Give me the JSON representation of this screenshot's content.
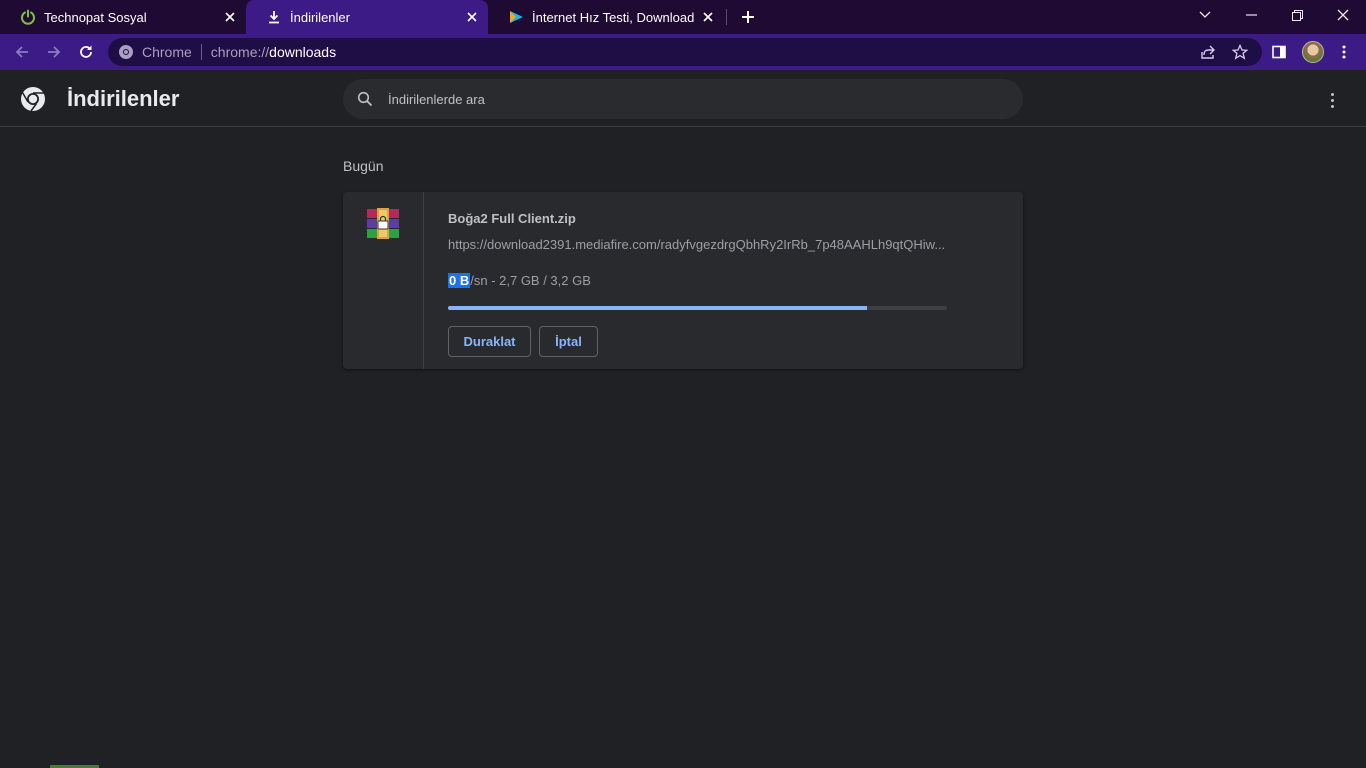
{
  "tabs": [
    {
      "title": "Technopat Sosyal",
      "icon": "power-icon",
      "active": false
    },
    {
      "title": "İndirilenler",
      "icon": "download-icon",
      "active": true
    },
    {
      "title": "İnternet Hız Testi, Download & Up",
      "icon": "play-icon",
      "active": false
    }
  ],
  "omnibox": {
    "site_label": "Chrome",
    "url_scheme": "chrome://",
    "url_host": "downloads"
  },
  "page": {
    "title": "İndirilenler",
    "search_placeholder": "İndirilenlerde ara"
  },
  "downloads": {
    "date_header": "Bugün",
    "items": [
      {
        "file_name": "Boğa2 Full Client.zip",
        "url": "https://download2391.mediafire.com/radyfvgezdrgQbhRy2IrRb_7p48AAHLh9qtQHiw...",
        "speed_value": "0 B",
        "status_rest": "/sn - 2,7 GB / 3,2 GB",
        "progress": 0.84,
        "pause_label": "Duraklat",
        "cancel_label": "İptal",
        "icon": "winrar-archive-icon"
      }
    ]
  },
  "colors": {
    "tabstrip": "#1f0a33",
    "toolbar": "#3c1b86",
    "page_bg": "#202124",
    "card_bg": "#292a2d",
    "accent": "#8ab4f8"
  }
}
